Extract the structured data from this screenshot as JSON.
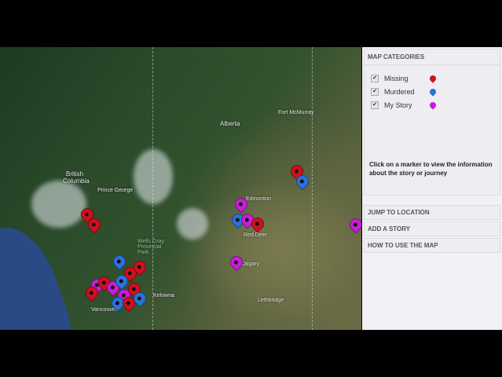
{
  "map": {
    "labels": {
      "alberta": "Alberta",
      "bc": "British Columbia",
      "edmonton": "Edmonton",
      "calgary": "Calgary",
      "vancouver": "Vancouver",
      "prince_george": "Prince George",
      "wells_gray": "Wells Gray Provincial Park",
      "lethbridge": "Lethbridge",
      "fort_mcmurray": "Fort McMurray",
      "kelowna": "Kelowna",
      "red_deer": "Red Deer"
    },
    "markers": [
      "Missing",
      "Missing",
      "Murdered",
      "Missing",
      "Missing",
      "My Story",
      "Missing",
      "My Story",
      "Murdered",
      "Missing",
      "My Story",
      "Murdered",
      "Missing",
      "Missing",
      "Murdered",
      "Missing",
      "Murdered",
      "My Story",
      "Murdered",
      "My Story",
      "Missing",
      "My Story",
      "My Story"
    ]
  },
  "colors": {
    "Missing": "#d0101e",
    "Murdered": "#2a72d8",
    "My Story": "#c81ed8"
  },
  "panel": {
    "title": "MAP CATEGORIES",
    "categories": [
      {
        "label": "Missing",
        "checked": true,
        "icon": "red-marker"
      },
      {
        "label": "Murdered",
        "checked": true,
        "icon": "blue-marker"
      },
      {
        "label": "My Story",
        "checked": true,
        "icon": "purple-marker"
      }
    ],
    "info": "Click on a marker to view the information about the story or journey",
    "sections": [
      "JUMP TO LOCATION",
      "ADD A STORY",
      "HOW TO USE THE MAP"
    ]
  }
}
